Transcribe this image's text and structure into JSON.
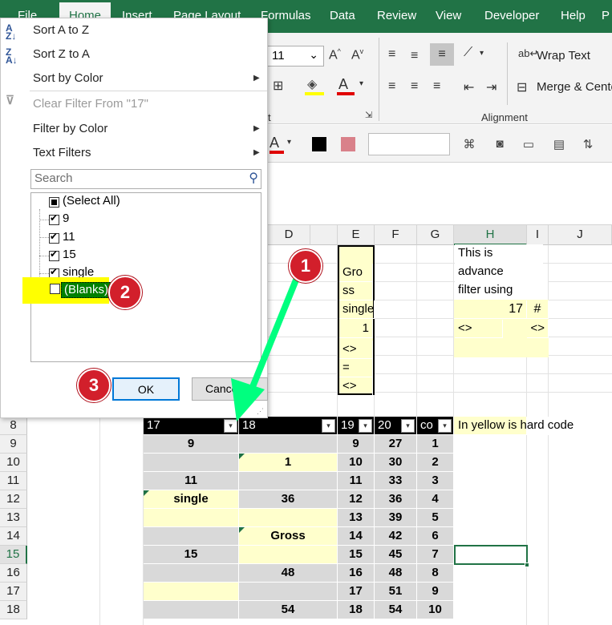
{
  "menu": {
    "file": "File",
    "home": "Home",
    "insert": "Insert",
    "page_layout": "Page Layout",
    "formulas": "Formulas",
    "data": "Data",
    "review": "Review",
    "view": "View",
    "developer": "Developer",
    "help": "Help",
    "p": "P"
  },
  "ribbon": {
    "font_size": "11",
    "wrap_text": "Wrap Text",
    "merge_center": "Merge & Cente",
    "alignment_label": "Alignment",
    "t_label": "t"
  },
  "filter": {
    "sort_a_z": "Sort A to Z",
    "sort_z_a": "Sort Z to A",
    "sort_by_color": "Sort by Color",
    "clear_filter": "Clear Filter From \"17\"",
    "filter_by_color": "Filter by Color",
    "text_filters": "Text Filters",
    "search_placeholder": "Search",
    "items": [
      {
        "label": "(Select All)",
        "state": "indeterminate"
      },
      {
        "label": "9",
        "state": "checked"
      },
      {
        "label": "11",
        "state": "checked"
      },
      {
        "label": "15",
        "state": "checked"
      },
      {
        "label": "single",
        "state": "checked"
      },
      {
        "label": "(Blanks)",
        "state": "unchecked"
      }
    ],
    "ok": "OK",
    "cancel": "Cancel"
  },
  "badges": [
    "1",
    "2",
    "3"
  ],
  "grid": {
    "columns": [
      "D",
      "E",
      "F",
      "G",
      "H",
      "I",
      "J"
    ],
    "rows": [
      "8",
      "9",
      "10",
      "11",
      "12",
      "13",
      "14",
      "15",
      "16",
      "17",
      "18"
    ],
    "e_col": [
      "Gro",
      "ss",
      "single",
      "1",
      "<>",
      "=",
      "<>"
    ],
    "h_col": [
      "This is",
      "advance",
      "filter using"
    ],
    "h_value": "17",
    "i_value": "#",
    "h_ne": "<>",
    "i_ne": "<>",
    "header_row": [
      "17",
      "18",
      "19",
      "20",
      "co"
    ],
    "note": "In yellow is hard code",
    "data_rows": [
      [
        "9",
        "",
        "9",
        "27",
        "1"
      ],
      [
        "",
        "1",
        "10",
        "30",
        "2"
      ],
      [
        "11",
        "",
        "11",
        "33",
        "3"
      ],
      [
        "single",
        "36",
        "12",
        "36",
        "4"
      ],
      [
        "",
        "",
        "13",
        "39",
        "5"
      ],
      [
        "",
        "Gross",
        "14",
        "42",
        "6"
      ],
      [
        "15",
        "",
        "15",
        "45",
        "7"
      ],
      [
        "",
        "48",
        "16",
        "48",
        "8"
      ],
      [
        "",
        "",
        "17",
        "51",
        "9"
      ],
      [
        "",
        "54",
        "18",
        "54",
        "10"
      ]
    ]
  },
  "colors": {
    "excel_green": "#217346",
    "highlight_yellow": "#ffff00",
    "arrow_green": "#00ff7f",
    "badge_red": "#d21f2b"
  }
}
